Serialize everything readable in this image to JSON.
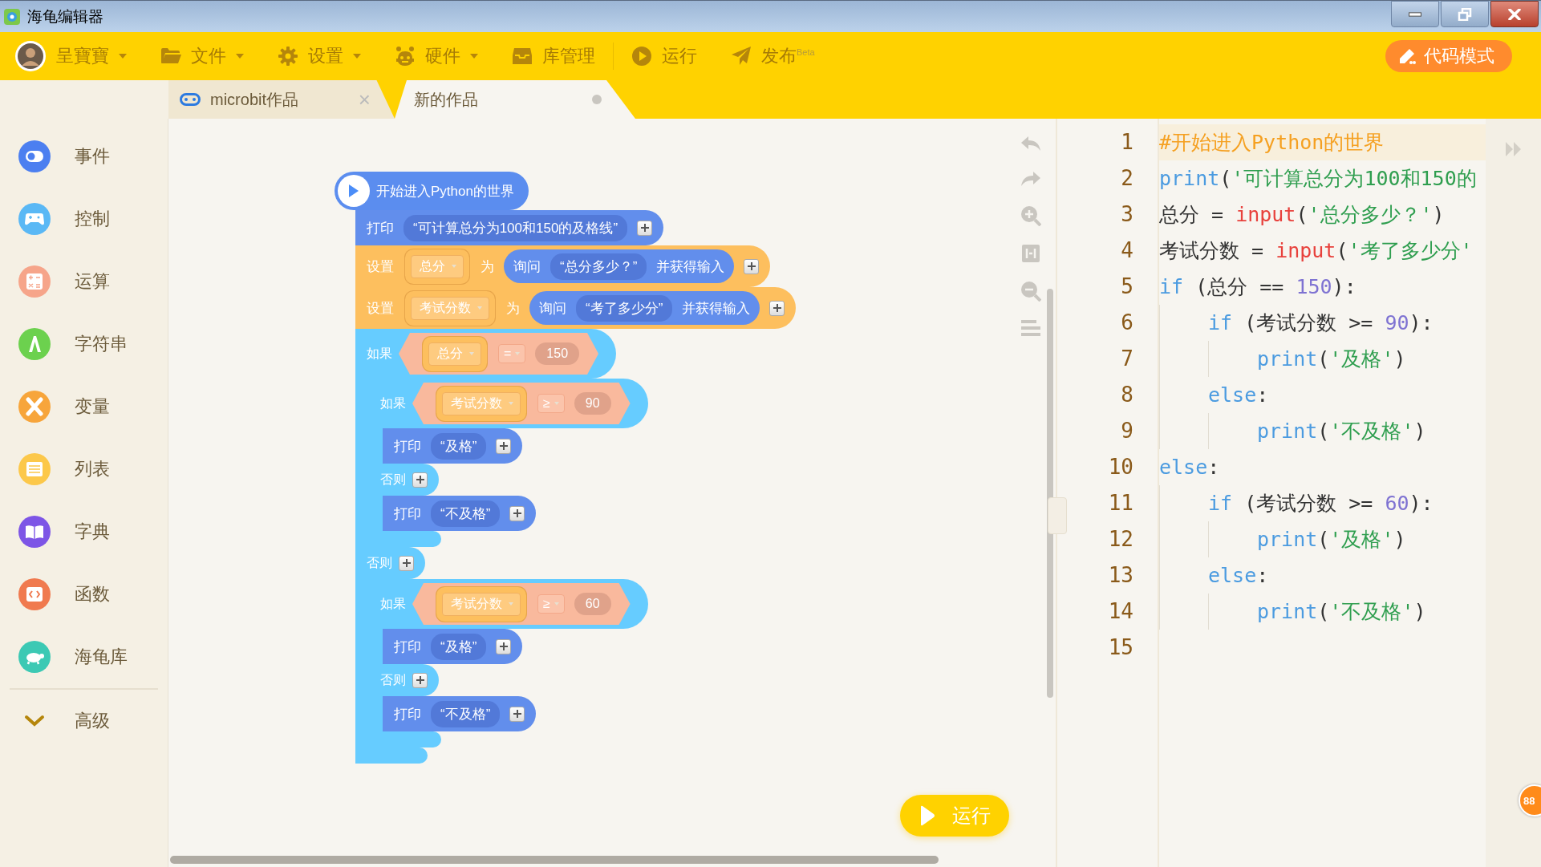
{
  "window": {
    "title": "海龟编辑器"
  },
  "menu": {
    "user": {
      "name": "呈寶寶",
      "dropdown": true
    },
    "items": [
      {
        "label": "文件",
        "dropdown": true
      },
      {
        "label": "设置",
        "dropdown": true
      },
      {
        "label": "硬件",
        "dropdown": true
      },
      {
        "label": "库管理",
        "dropdown": false
      },
      {
        "label": "运行",
        "dropdown": false
      },
      {
        "label": "发布$^{Beta}$",
        "dropdown": false
      }
    ],
    "mode_button": "代码模式"
  },
  "tabs": [
    {
      "label": "microbit作品",
      "selected": false,
      "close": "×",
      "modified": false
    },
    {
      "label": "新的作品",
      "selected": true,
      "modified": true
    }
  ],
  "sidebar": {
    "categories": [
      {
        "label": "事件",
        "color": "#4c7ff0"
      },
      {
        "label": "控制",
        "color": "#5ab8f5"
      },
      {
        "label": "运算",
        "color": "#f6a58a"
      },
      {
        "label": "字符串",
        "color": "#6cd14e"
      },
      {
        "label": "变量",
        "color": "#f7a53b"
      },
      {
        "label": "列表",
        "color": "#fcc84a"
      },
      {
        "label": "字典",
        "color": "#7d55e6"
      },
      {
        "label": "函数",
        "color": "#f07a4f"
      },
      {
        "label": "海龟库",
        "color": "#3cc9b4"
      }
    ],
    "advanced": "高级"
  },
  "blocks": [
    {
      "kind": "hat",
      "label": "开始进入Python的世界"
    },
    {
      "kind": "print",
      "label": "打印",
      "value": "“可计算总分为100和150的及格线”"
    },
    {
      "kind": "set",
      "label": "设置",
      "variable": "总分",
      "to": "为",
      "ask": {
        "label": "询问",
        "value": "“总分多少？”",
        "suffix": "并获得输入"
      }
    },
    {
      "kind": "set",
      "label": "设置",
      "variable": "考试分数",
      "to": "为",
      "ask": {
        "label": "询问",
        "value": "“考了多少分”",
        "suffix": "并获得输入"
      }
    },
    {
      "kind": "if_else",
      "label": "如果",
      "condition": {
        "variable": "总分",
        "operator": "=",
        "value": "150"
      },
      "else_label": "否则",
      "then": [
        {
          "kind": "if_else",
          "label": "如果",
          "condition": {
            "variable": "考试分数",
            "operator": "≥",
            "value": "90"
          },
          "else_label": "否则",
          "then": [
            {
              "kind": "print",
              "label": "打印",
              "value": "“及格”"
            }
          ],
          "else": [
            {
              "kind": "print",
              "label": "打印",
              "value": "“不及格”"
            }
          ]
        }
      ],
      "else": [
        {
          "kind": "if_else",
          "label": "如果",
          "condition": {
            "variable": "考试分数",
            "operator": "≥",
            "value": "60"
          },
          "else_label": "否则",
          "then": [
            {
              "kind": "print",
              "label": "打印",
              "value": "“及格”"
            }
          ],
          "else": [
            {
              "kind": "print",
              "label": "打印",
              "value": "“不及格”"
            }
          ]
        }
      ]
    }
  ],
  "run_button": "运行",
  "code": {
    "lines": [
      {
        "number": "1",
        "highlighted": true,
        "tokens": [
          {
            "kind": "comment",
            "text": "#开始进入Python的世界"
          }
        ]
      },
      {
        "number": "2",
        "highlighted": false,
        "tokens": [
          {
            "kind": "builtin",
            "text": "print"
          },
          {
            "kind": "plain",
            "text": "("
          },
          {
            "kind": "string",
            "text": "'可计算总分为100和150的"
          }
        ]
      },
      {
        "number": "3",
        "highlighted": false,
        "tokens": [
          {
            "kind": "plain",
            "text": "总分 = "
          },
          {
            "kind": "call",
            "text": "input"
          },
          {
            "kind": "plain",
            "text": "("
          },
          {
            "kind": "string",
            "text": "'总分多少？'"
          },
          {
            "kind": "plain",
            "text": ")"
          }
        ]
      },
      {
        "number": "4",
        "highlighted": false,
        "tokens": [
          {
            "kind": "plain",
            "text": "考试分数 = "
          },
          {
            "kind": "call",
            "text": "input"
          },
          {
            "kind": "plain",
            "text": "("
          },
          {
            "kind": "string",
            "text": "'考了多少分'"
          }
        ]
      },
      {
        "number": "5",
        "highlighted": false,
        "tokens": [
          {
            "kind": "keyword",
            "text": "if"
          },
          {
            "kind": "plain",
            "text": " (总分 == "
          },
          {
            "kind": "number",
            "text": "150"
          },
          {
            "kind": "plain",
            "text": "):"
          }
        ],
        "children": [
          {
            "number": "6",
            "highlighted": false,
            "tokens": [
              {
                "kind": "keyword",
                "text": "if"
              },
              {
                "kind": "plain",
                "text": " (考试分数 >= "
              },
              {
                "kind": "number",
                "text": "90"
              },
              {
                "kind": "plain",
                "text": "):"
              }
            ],
            "children": [
              {
                "number": "7",
                "highlighted": false,
                "tokens": [
                  {
                    "kind": "builtin",
                    "text": "print"
                  },
                  {
                    "kind": "plain",
                    "text": "("
                  },
                  {
                    "kind": "string",
                    "text": "'及格'"
                  },
                  {
                    "kind": "plain",
                    "text": ")"
                  }
                ]
              }
            ]
          },
          {
            "number": "8",
            "highlighted": false,
            "tokens": [
              {
                "kind": "keyword",
                "text": "else"
              },
              {
                "kind": "plain",
                "text": ":"
              }
            ],
            "children": [
              {
                "number": "9",
                "highlighted": false,
                "tokens": [
                  {
                    "kind": "builtin",
                    "text": "print"
                  },
                  {
                    "kind": "plain",
                    "text": "("
                  },
                  {
                    "kind": "string",
                    "text": "'不及格'"
                  },
                  {
                    "kind": "plain",
                    "text": ")"
                  }
                ]
              }
            ]
          }
        ]
      },
      {
        "number": "10",
        "highlighted": false,
        "tokens": [
          {
            "kind": "keyword",
            "text": "else"
          },
          {
            "kind": "plain",
            "text": ":"
          }
        ],
        "children": [
          {
            "number": "11",
            "highlighted": false,
            "tokens": [
              {
                "kind": "keyword",
                "text": "if"
              },
              {
                "kind": "plain",
                "text": " (考试分数 >= "
              },
              {
                "kind": "number",
                "text": "60"
              },
              {
                "kind": "plain",
                "text": "):"
              }
            ],
            "children": [
              {
                "number": "12",
                "highlighted": false,
                "tokens": [
                  {
                    "kind": "builtin",
                    "text": "print"
                  },
                  {
                    "kind": "plain",
                    "text": "("
                  },
                  {
                    "kind": "string",
                    "text": "'及格'"
                  },
                  {
                    "kind": "plain",
                    "text": ")"
                  }
                ]
              }
            ]
          },
          {
            "number": "13",
            "highlighted": false,
            "tokens": [
              {
                "kind": "keyword",
                "text": "else"
              },
              {
                "kind": "plain",
                "text": ":"
              }
            ],
            "children": [
              {
                "number": "14",
                "highlighted": false,
                "tokens": [
                  {
                    "kind": "builtin",
                    "text": "print"
                  },
                  {
                    "kind": "plain",
                    "text": "("
                  },
                  {
                    "kind": "string",
                    "text": "'不及格'"
                  },
                  {
                    "kind": "plain",
                    "text": ")"
                  }
                ]
              }
            ]
          }
        ]
      },
      {
        "number": "15",
        "highlighted": false
      }
    ]
  },
  "badge": "88"
}
